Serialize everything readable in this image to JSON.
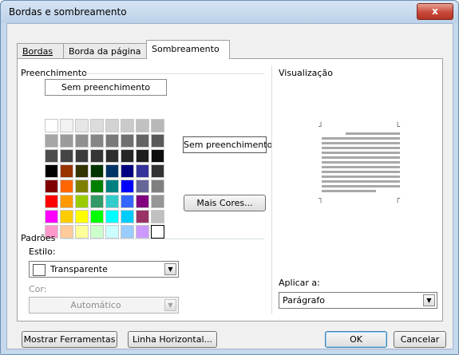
{
  "window": {
    "title": "Bordas e sombreamento",
    "close_glyph": "x"
  },
  "tabs": [
    {
      "label": "Bordas"
    },
    {
      "label": "Borda da página"
    },
    {
      "label": "Sombreamento"
    }
  ],
  "fill": {
    "group_label": "Preenchimento",
    "selected_label": "Sem preenchimento",
    "preview_label": "Sem preenchimento",
    "more_colors_label": "Mais Cores...",
    "palette": [
      [
        "#ffffff",
        "#f2f2f2",
        "#e6e6e6",
        "#dcdcdc",
        "#d3d3d3",
        "#cacaca",
        "#c1c1c1",
        "#b8b8b8"
      ],
      [
        "#a6a6a6",
        "#9b9b9b",
        "#909090",
        "#858585",
        "#7a7a7a",
        "#6f6f6f",
        "#646464",
        "#595959"
      ],
      [
        "#4d4d4d",
        "#454545",
        "#3d3d3d",
        "#353535",
        "#2d2d2d",
        "#262626",
        "#1e1e1e",
        "#0d0d0d"
      ],
      [
        "#000000",
        "#993300",
        "#333300",
        "#003300",
        "#003366",
        "#000080",
        "#333399",
        "#333333"
      ],
      [
        "#800000",
        "#ff6600",
        "#808000",
        "#008000",
        "#008080",
        "#0000ff",
        "#666699",
        "#808080"
      ],
      [
        "#ff0000",
        "#ff9900",
        "#99cc00",
        "#339966",
        "#33cccc",
        "#3366ff",
        "#800080",
        "#969696"
      ],
      [
        "#ff00ff",
        "#ffcc00",
        "#ffff00",
        "#00ff00",
        "#00ffff",
        "#00ccff",
        "#993366",
        "#c0c0c0"
      ],
      [
        "#ff99cc",
        "#ffcc99",
        "#ffff99",
        "#ccffcc",
        "#ccffff",
        "#99ccff",
        "#cc99ff",
        "#ffffff"
      ]
    ]
  },
  "patterns": {
    "group_label": "Padrões",
    "style_label": "Estilo:",
    "style_value": "Transparente",
    "color_label": "Cor:",
    "color_value": "Automático"
  },
  "preview": {
    "label": "Visualização",
    "apply_label": "Aplicar a:",
    "apply_value": "Parágrafo"
  },
  "footer": {
    "show_toolbar_label": "Mostrar Ferramentas",
    "horizontal_line_label": "Linha Horizontal...",
    "ok_label": "OK",
    "cancel_label": "Cancelar"
  }
}
